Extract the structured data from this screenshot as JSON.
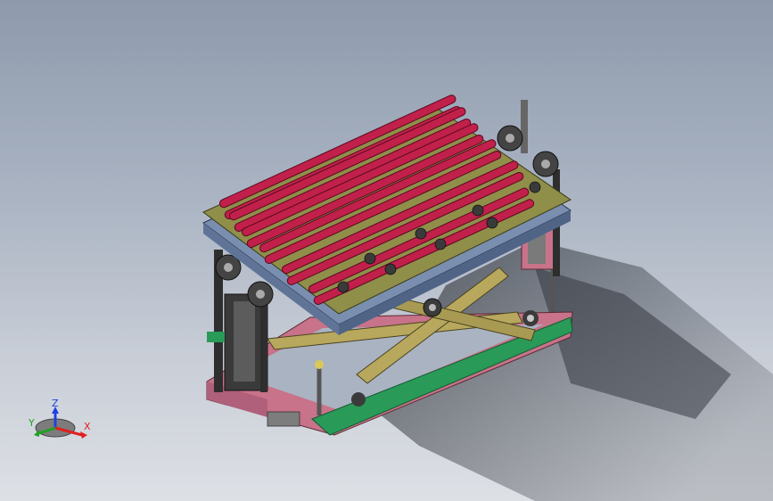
{
  "viewport": {
    "background_top": "#8e9aac",
    "background_bottom": "#dde0e5"
  },
  "model": {
    "belt_color": "#c0204a",
    "frame_color": "#8f8f4a",
    "base_color": "#c8738a",
    "base_edge_color": "#2a9a58",
    "scissor_color": "#b8a85e",
    "plate_color": "#7a8fb0",
    "chain_color": "#3a3a3a"
  },
  "triad": {
    "x_label": "X",
    "y_label": "Y",
    "z_label": "Z",
    "x_color": "#e02020",
    "y_color": "#20a020",
    "z_color": "#2040e0"
  }
}
